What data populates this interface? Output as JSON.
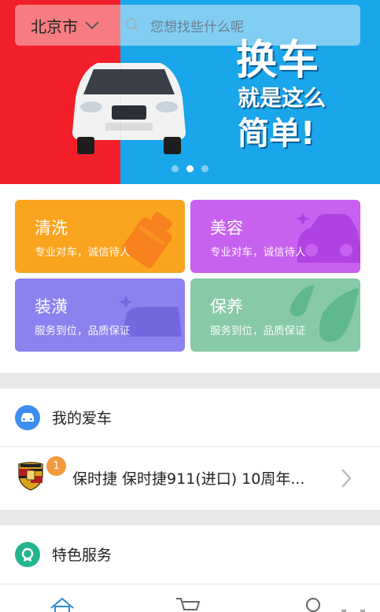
{
  "header": {
    "city": "北京市",
    "search_placeholder": "您想找些什么呢"
  },
  "banner": {
    "line1": "换车",
    "line2": "就是这么",
    "line3": "简单!",
    "slides": 3,
    "active_slide": 2,
    "colors": {
      "left": "#f21f2a",
      "right": "#1aa6ea"
    }
  },
  "services": [
    {
      "title": "清洗",
      "subtitle": "专业对车，诚信待人",
      "color": "#fba41f"
    },
    {
      "title": "美容",
      "subtitle": "专业对车，诚信待人",
      "color": "#c861f0"
    },
    {
      "title": "装潢",
      "subtitle": "服务到位，品质保证",
      "color": "#8c82ef"
    },
    {
      "title": "保养",
      "subtitle": "服务到位，品质保证",
      "color": "#88c9a8"
    }
  ],
  "my_car": {
    "title": "我的爱车",
    "icon": "car-icon",
    "car_name": "保时捷  保时捷911(进口)  10周年...",
    "badge_count": "1"
  },
  "special": {
    "title": "特色服务",
    "icon": "award-icon"
  },
  "tabs": [
    {
      "icon": "home-icon",
      "active": true
    },
    {
      "icon": "cart-icon",
      "active": false
    },
    {
      "icon": "profile-icon",
      "active": false
    }
  ]
}
